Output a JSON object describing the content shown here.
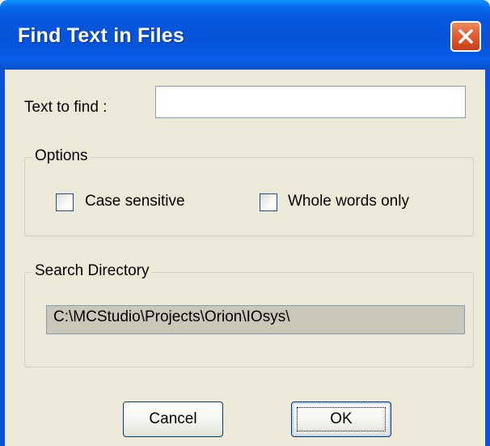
{
  "window": {
    "title": "Find Text in Files"
  },
  "icons": {
    "close": "close-icon"
  },
  "form": {
    "text_to_find_label": "Text to find :",
    "text_to_find_value": ""
  },
  "options": {
    "title": "Options",
    "case_sensitive_label": "Case sensitive",
    "case_sensitive_checked": false,
    "whole_words_label": "Whole words only",
    "whole_words_checked": false
  },
  "search_directory": {
    "title": "Search Directory",
    "path": "C:\\MCStudio\\Projects\\Orion\\IOsys\\"
  },
  "buttons": {
    "cancel": "Cancel",
    "ok": "OK"
  },
  "colors": {
    "titlebar": "#0553d9",
    "dialog_bg": "#ece9d8",
    "close_button": "#e05a2c",
    "readonly_field": "#c9c7ba"
  }
}
